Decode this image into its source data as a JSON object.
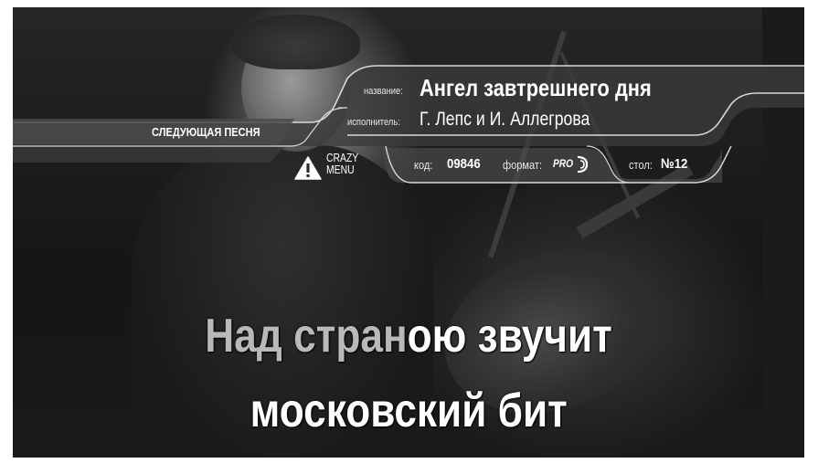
{
  "next_song_label": "СЛЕДУЮЩАЯ ПЕСНЯ",
  "song": {
    "title_label": "название:",
    "title": "Ангел завтрешнего дня",
    "artist_label": "исполнитель:",
    "artist": "Г. Лепс и И. Аллегрова"
  },
  "details": {
    "code_label": "код:",
    "code": "09846",
    "format_label": "формат:",
    "format": "PRO",
    "table_label": "стол:",
    "table": "№12"
  },
  "crazy_menu": {
    "icon": "warning-triangle-icon",
    "line1": "CRAZY",
    "line2": "MENU"
  },
  "lyrics": {
    "line1_sung": "Над стран",
    "line1_rest": "ою звучит",
    "line2": "московский бит"
  },
  "colors": {
    "overlay": "#3b3b3b",
    "outline": "#d8d8d8",
    "sung_text": "#b9b9b9",
    "text": "#ffffff"
  }
}
